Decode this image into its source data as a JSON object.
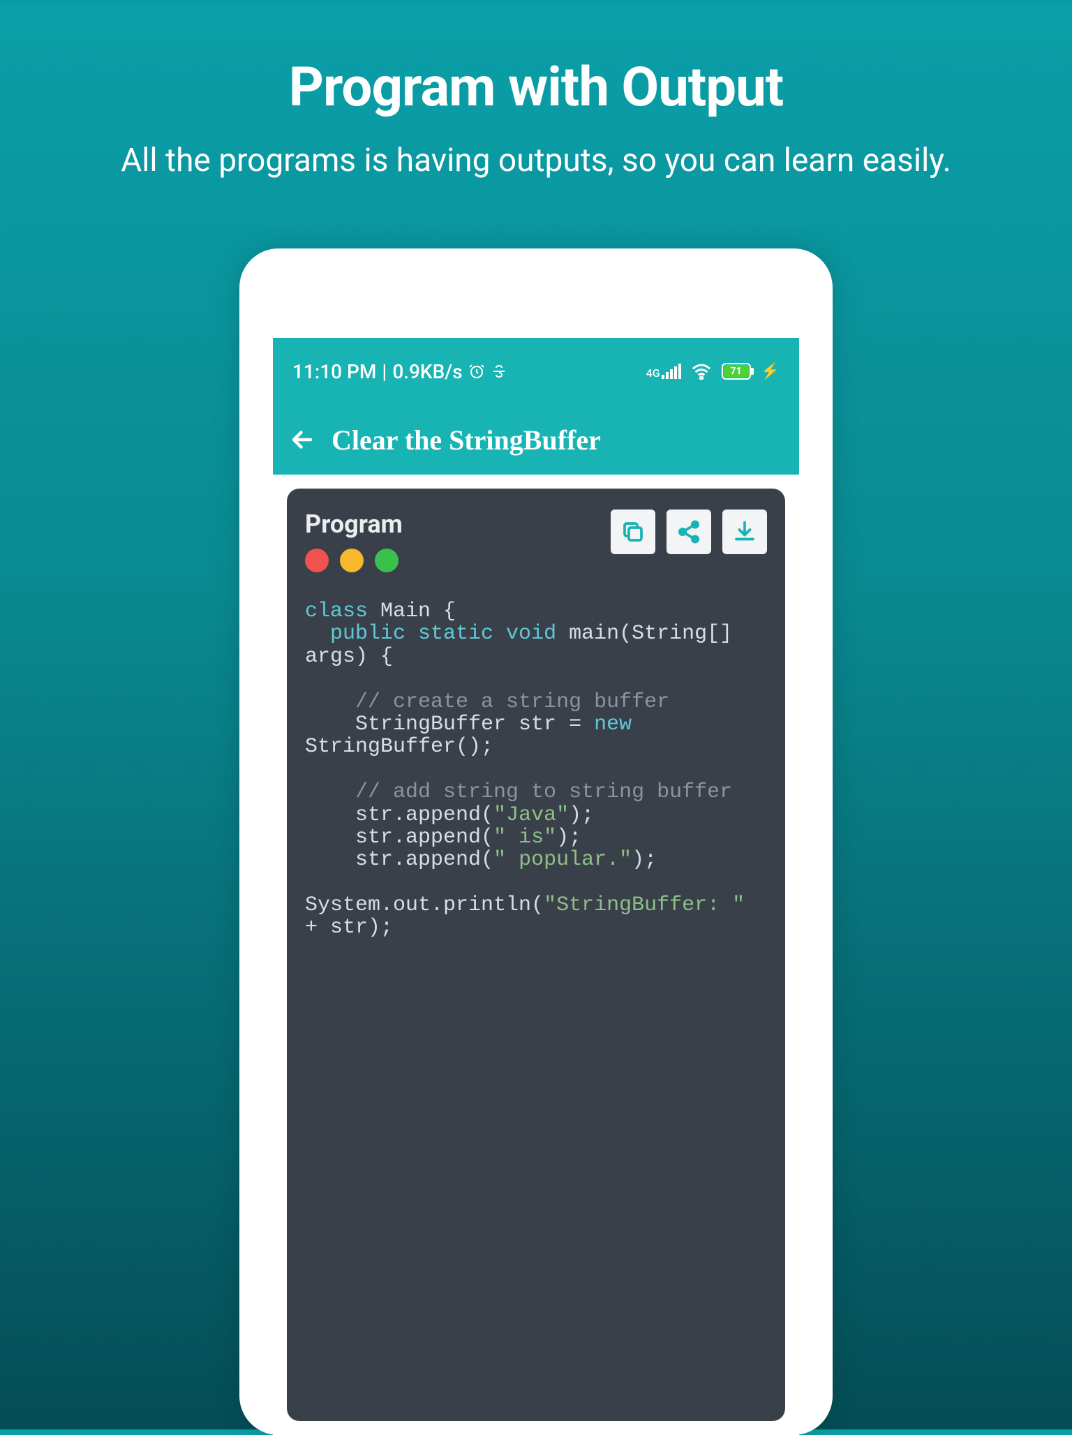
{
  "promo": {
    "title": "Program with Output",
    "subtitle": "All the programs is having outputs, so you can learn easily."
  },
  "status": {
    "time": "11:10 PM",
    "net_speed": "0.9KB/s",
    "net_type": "4G",
    "battery_pct": "71"
  },
  "appbar": {
    "title": "Clear the StringBuffer"
  },
  "section_label": "Program",
  "code": {
    "l1_kw": "class",
    "l1_name": " Main {",
    "l2_mod": "public static void",
    "l2_sig": " main(String[] args) {",
    "l3_cmt": "// create a string buffer",
    "l4_a": "StringBuffer str = ",
    "l4_new": "new",
    "l4_b": " StringBuffer();",
    "l5_cmt": "// add string to string buffer",
    "l6_a": "str.append(",
    "l6_s": "\"Java\"",
    "l6_b": ");",
    "l7_a": "str.append(",
    "l7_s": "\" is\"",
    "l7_b": ");",
    "l8_a": "str.append(",
    "l8_s": "\" popular.\"",
    "l8_b": ");",
    "l9_a": "System.out.println(",
    "l9_s": "\"StringBuffer: \"",
    "l9_b": " + str);"
  }
}
